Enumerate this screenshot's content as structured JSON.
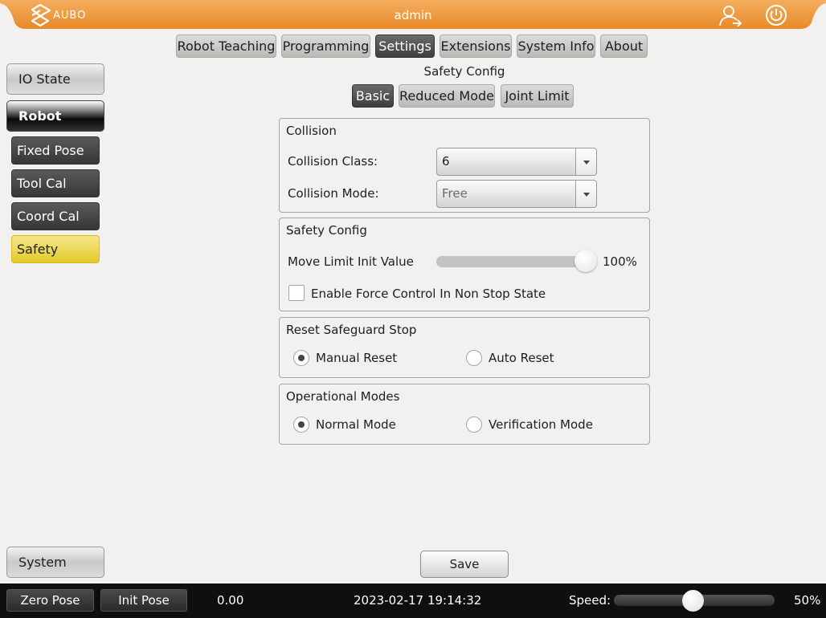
{
  "header": {
    "logo_text": "AUBO",
    "username": "admin",
    "user_icon": "user-switch-icon",
    "power_icon": "power-icon",
    "accent_color": "#ef9a3a"
  },
  "tabs": [
    {
      "label": "Robot Teaching"
    },
    {
      "label": "Programming"
    },
    {
      "label": "Settings",
      "active": true
    },
    {
      "label": "Extensions"
    },
    {
      "label": "System Info"
    },
    {
      "label": "About"
    }
  ],
  "page_title": "Safety Config",
  "subtabs": [
    {
      "label": "Basic",
      "active": true
    },
    {
      "label": "Reduced Mode"
    },
    {
      "label": "Joint Limit"
    }
  ],
  "sidebar": {
    "io_state": "IO State",
    "robot": "Robot",
    "items": [
      {
        "label": "Fixed Pose"
      },
      {
        "label": "Tool Cal"
      },
      {
        "label": "Coord Cal"
      },
      {
        "label": "Safety",
        "active": true
      }
    ],
    "system": "System"
  },
  "collision": {
    "title": "Collision",
    "class_label": "Collision Class:",
    "class_value": "6",
    "mode_label": "Collision Mode:",
    "mode_value": "Free"
  },
  "safety_config": {
    "title": "Safety Config",
    "move_limit_label": "Move Limit Init Value",
    "move_limit_value": "100%",
    "move_limit_fraction": 1.0,
    "force_control_label": "Enable Force Control In Non Stop State",
    "force_control_checked": false
  },
  "reset_safeguard": {
    "title": "Reset Safeguard Stop",
    "manual_label": "Manual Reset",
    "auto_label": "Auto Reset",
    "selected": "manual"
  },
  "operational_modes": {
    "title": "Operational Modes",
    "normal_label": "Normal Mode",
    "verification_label": "Verification Mode",
    "selected": "normal"
  },
  "save_label": "Save",
  "footer": {
    "zero_pose": "Zero Pose",
    "init_pose": "Init Pose",
    "value": "0.00",
    "datetime": "2023-02-17 19:14:32",
    "speed_label": "Speed:",
    "speed_value": "50%",
    "speed_fraction": 0.5
  }
}
